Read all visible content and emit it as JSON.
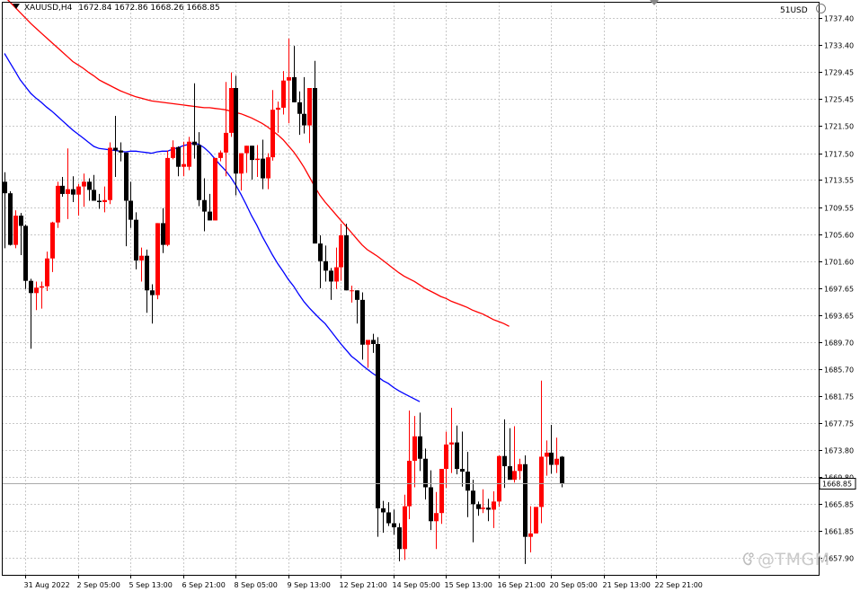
{
  "header": {
    "symbol": "XAUUSD,H4",
    "ohlc": "1672.84 1672.86 1668.26 1668.85",
    "account_tag": "51USD"
  },
  "current_price_label": "1668.85",
  "watermark": {
    "text": "@TMGM",
    "icon": "weibo-icon"
  },
  "colors": {
    "bull": "#ff0000",
    "bear": "#000000",
    "ma_slow": "#ff0000",
    "ma_fast": "#0000ff",
    "grid": "#c8c8c8",
    "background": "#ffffff"
  },
  "chart_data": {
    "type": "candlestick",
    "title": "",
    "xlabel": "",
    "ylabel": "",
    "timeframe": "H4",
    "ylim": [
      1655.4,
      1739.8
    ],
    "grid": true,
    "y_ticks": [
      1737.4,
      1733.4,
      1729.45,
      1725.45,
      1721.5,
      1717.5,
      1713.55,
      1709.55,
      1705.6,
      1701.6,
      1697.65,
      1693.65,
      1689.7,
      1685.7,
      1681.75,
      1677.75,
      1673.8,
      1669.8,
      1665.85,
      1661.85,
      1657.9
    ],
    "x_ticks": [
      {
        "label": "31 Aug 2022",
        "bar": 4
      },
      {
        "label": "2 Sep 05:00",
        "bar": 14
      },
      {
        "label": "5 Sep 13:00",
        "bar": 24
      },
      {
        "label": "6 Sep 21:00",
        "bar": 34
      },
      {
        "label": "8 Sep 05:00",
        "bar": 44
      },
      {
        "label": "9 Sep 13:00",
        "bar": 54
      },
      {
        "label": "12 Sep 21:00",
        "bar": 64
      },
      {
        "label": "14 Sep 05:00",
        "bar": 74
      },
      {
        "label": "15 Sep 13:00",
        "bar": 84
      },
      {
        "label": "16 Sep 21:00",
        "bar": 94
      },
      {
        "label": "20 Sep 05:00",
        "bar": 104
      },
      {
        "label": "21 Sep 13:00",
        "bar": 114
      },
      {
        "label": "22 Sep 21:00",
        "bar": 124
      }
    ],
    "candles": [
      [
        1713.3,
        1714.7,
        1703.5,
        1711.6
      ],
      [
        1711.6,
        1711.9,
        1703.9,
        1704.0
      ],
      [
        1704.0,
        1709.1,
        1703.5,
        1708.3
      ],
      [
        1708.3,
        1708.7,
        1702.5,
        1706.8
      ],
      [
        1706.8,
        1707.0,
        1697.5,
        1698.7
      ],
      [
        1698.7,
        1699.0,
        1688.7,
        1696.9
      ],
      [
        1696.9,
        1698.6,
        1694.4,
        1697.7
      ],
      [
        1697.7,
        1698.6,
        1694.6,
        1697.9
      ],
      [
        1697.9,
        1703.0,
        1697.2,
        1702.0
      ],
      [
        1702.0,
        1707.4,
        1700.0,
        1707.3
      ],
      [
        1707.3,
        1713.3,
        1706.5,
        1712.7
      ],
      [
        1712.7,
        1714.0,
        1711.1,
        1711.5
      ],
      [
        1711.5,
        1718.2,
        1707.8,
        1712.2
      ],
      [
        1712.2,
        1714.1,
        1710.3,
        1711.4
      ],
      [
        1711.4,
        1713.0,
        1708.3,
        1712.6
      ],
      [
        1712.6,
        1714.5,
        1709.6,
        1713.3
      ],
      [
        1713.3,
        1713.8,
        1710.5,
        1712.1
      ],
      [
        1712.1,
        1714.3,
        1711.6,
        1710.5
      ],
      [
        1710.5,
        1711.5,
        1709.3,
        1710.3
      ],
      [
        1710.3,
        1712.6,
        1708.8,
        1710.6
      ],
      [
        1710.6,
        1719.1,
        1710.0,
        1718.3
      ],
      [
        1718.3,
        1723.0,
        1714.0,
        1717.9
      ],
      [
        1717.9,
        1719.1,
        1716.3,
        1717.6
      ],
      [
        1717.6,
        1716.2,
        1703.8,
        1710.5
      ],
      [
        1710.5,
        1713.3,
        1706.5,
        1707.7
      ],
      [
        1707.7,
        1708.8,
        1700.4,
        1701.7
      ],
      [
        1701.7,
        1703.6,
        1698.6,
        1702.4
      ],
      [
        1702.4,
        1703.3,
        1694.0,
        1697.3
      ],
      [
        1697.3,
        1698.2,
        1692.4,
        1696.6
      ],
      [
        1696.6,
        1707.2,
        1696.0,
        1707.2
      ],
      [
        1707.2,
        1709.4,
        1702.8,
        1704.0
      ],
      [
        1704.0,
        1717.9,
        1703.8,
        1716.8
      ],
      [
        1716.8,
        1719.4,
        1716.6,
        1718.4
      ],
      [
        1718.4,
        1718.5,
        1714.1,
        1715.5
      ],
      [
        1715.5,
        1719.2,
        1714.1,
        1715.9
      ],
      [
        1715.5,
        1719.9,
        1715.0,
        1719.2
      ],
      [
        1719.2,
        1727.8,
        1716.7,
        1718.7
      ],
      [
        1718.7,
        1720.6,
        1709.7,
        1710.6
      ],
      [
        1710.6,
        1713.8,
        1706.0,
        1708.9
      ],
      [
        1708.9,
        1711.5,
        1707.8,
        1707.6
      ],
      [
        1707.6,
        1712.7,
        1714.2,
        1716.8
      ],
      [
        1716.8,
        1717.9,
        1716.3,
        1717.6
      ],
      [
        1717.6,
        1728.0,
        1714.1,
        1720.5
      ],
      [
        1720.5,
        1729.4,
        1719.9,
        1727.1
      ],
      [
        1727.1,
        1728.9,
        1711.3,
        1714.5
      ],
      [
        1714.5,
        1716.9,
        1712.0,
        1717.5
      ],
      [
        1717.5,
        1718.4,
        1714.6,
        1718.6
      ],
      [
        1718.6,
        1717.0,
        1713.6,
        1716.5
      ],
      [
        1716.5,
        1718.7,
        1714.0,
        1716.7
      ],
      [
        1716.7,
        1719.5,
        1712.2,
        1713.8
      ],
      [
        1713.8,
        1717.5,
        1712.2,
        1716.9
      ],
      [
        1716.9,
        1726.8,
        1716.4,
        1723.9
      ],
      [
        1723.9,
        1725.1,
        1720.5,
        1724.2
      ],
      [
        1724.2,
        1729.6,
        1723.2,
        1728.2
      ],
      [
        1728.2,
        1734.4,
        1721.9,
        1728.7
      ],
      [
        1728.7,
        1733.3,
        1727.3,
        1725.0
      ],
      [
        1725.0,
        1726.6,
        1720.2,
        1723.3
      ],
      [
        1723.3,
        1728.7,
        1720.4,
        1721.6
      ],
      [
        1721.6,
        1725.9,
        1719.0,
        1727.1
      ],
      [
        1727.1,
        1731.1,
        1720.7,
        1704.2
      ],
      [
        1704.2,
        1705.4,
        1697.6,
        1701.6
      ],
      [
        1701.6,
        1703.9,
        1698.6,
        1700.2
      ],
      [
        1700.2,
        1700.6,
        1695.9,
        1698.6
      ],
      [
        1698.6,
        1703.6,
        1697.5,
        1700.7
      ],
      [
        1700.7,
        1707.1,
        1698.7,
        1705.4
      ],
      [
        1705.4,
        1707.1,
        1698.6,
        1697.3
      ],
      [
        1697.3,
        1698.0,
        1695.5,
        1697.3
      ],
      [
        1697.3,
        1696.4,
        1692.4,
        1695.9
      ],
      [
        1695.9,
        1697.0,
        1687.1,
        1689.3
      ],
      [
        1689.3,
        1688.5,
        1685.9,
        1690.0
      ],
      [
        1690.0,
        1690.9,
        1688.1,
        1689.4
      ],
      [
        1689.4,
        1690.4,
        1661.0,
        1665.2
      ],
      [
        1665.2,
        1666.3,
        1661.6,
        1664.6
      ],
      [
        1664.6,
        1666.1,
        1662.6,
        1663.0
      ],
      [
        1663.0,
        1665.0,
        1661.3,
        1662.4
      ],
      [
        1662.4,
        1663.0,
        1657.4,
        1659.2
      ],
      [
        1659.2,
        1667.2,
        1657.6,
        1665.5
      ],
      [
        1665.5,
        1679.6,
        1663.6,
        1672.2
      ],
      [
        1672.2,
        1678.8,
        1668.3,
        1675.8
      ],
      [
        1675.8,
        1679.3,
        1670.7,
        1672.5
      ],
      [
        1672.5,
        1674.0,
        1666.5,
        1668.3
      ],
      [
        1668.3,
        1670.8,
        1662.0,
        1663.3
      ],
      [
        1663.3,
        1667.6,
        1659.2,
        1664.5
      ],
      [
        1664.5,
        1670.6,
        1662.9,
        1671.0
      ],
      [
        1671.0,
        1676.5,
        1668.2,
        1674.6
      ],
      [
        1674.6,
        1680.0,
        1670.4,
        1674.9
      ],
      [
        1674.9,
        1677.4,
        1670.2,
        1671.0
      ],
      [
        1671.0,
        1676.5,
        1668.4,
        1670.6
      ],
      [
        1670.6,
        1673.5,
        1663.9,
        1667.8
      ],
      [
        1667.8,
        1669.4,
        1660.2,
        1665.8
      ],
      [
        1665.8,
        1666.2,
        1664.1,
        1665.1
      ],
      [
        1665.1,
        1668.0,
        1664.5,
        1665.3
      ],
      [
        1665.3,
        1666.6,
        1663.3,
        1665.0
      ],
      [
        1665.0,
        1667.7,
        1662.3,
        1666.2
      ],
      [
        1666.2,
        1673.0,
        1665.4,
        1672.9
      ],
      [
        1672.9,
        1678.3,
        1668.2,
        1671.4
      ],
      [
        1671.4,
        1677.0,
        1669.5,
        1669.4
      ],
      [
        1669.4,
        1677.3,
        1669.0,
        1670.7
      ],
      [
        1670.7,
        1672.5,
        1669.4,
        1671.7
      ],
      [
        1671.7,
        1673.0,
        1657.0,
        1661.0
      ],
      [
        1661.0,
        1665.5,
        1658.7,
        1661.5
      ],
      [
        1661.5,
        1663.6,
        1662.0,
        1665.4
      ],
      [
        1665.4,
        1684.0,
        1663.0,
        1672.8
      ],
      [
        1672.8,
        1675.2,
        1670.0,
        1673.4
      ],
      [
        1673.4,
        1677.5,
        1670.3,
        1671.6
      ],
      [
        1671.6,
        1675.6,
        1670.4,
        1672.5
      ],
      [
        1672.8,
        1672.9,
        1668.3,
        1668.9
      ]
    ],
    "series": [
      {
        "type": "ma",
        "color": "#ff0000",
        "values": [
          1740.6,
          1739.8,
          1739.0,
          1738.2,
          1737.4,
          1736.6,
          1735.9,
          1735.2,
          1734.5,
          1733.8,
          1733.1,
          1732.4,
          1731.7,
          1731.0,
          1730.5,
          1730.0,
          1729.4,
          1728.9,
          1728.3,
          1727.9,
          1727.5,
          1727.1,
          1726.7,
          1726.4,
          1726.1,
          1725.8,
          1725.6,
          1725.4,
          1725.2,
          1725.1,
          1725.0,
          1724.9,
          1724.8,
          1724.7,
          1724.6,
          1724.5,
          1724.4,
          1724.3,
          1724.2,
          1724.2,
          1724.1,
          1724.0,
          1723.9,
          1723.7,
          1723.5,
          1723.3,
          1723.0,
          1722.7,
          1722.3,
          1721.9,
          1721.4,
          1720.8,
          1720.2,
          1719.5,
          1718.6,
          1717.7,
          1716.6,
          1715.4,
          1714.0,
          1712.6,
          1711.3,
          1710.3,
          1709.4,
          1708.5,
          1707.6,
          1706.7,
          1705.8,
          1704.9,
          1704.0,
          1703.3,
          1702.8,
          1702.3,
          1701.7,
          1701.1,
          1700.5,
          1699.9,
          1699.4,
          1699.0,
          1698.6,
          1698.1,
          1697.6,
          1697.2,
          1696.8,
          1696.4,
          1696.1,
          1695.7,
          1695.4,
          1695.1,
          1694.8,
          1694.4,
          1694.1,
          1693.8,
          1693.4,
          1693.0,
          1692.7,
          1692.4,
          1692.0
        ]
      },
      {
        "type": "ma",
        "color": "#0000ff",
        "values": [
          1732.2,
          1730.9,
          1729.6,
          1728.3,
          1727.3,
          1726.3,
          1725.6,
          1725.0,
          1724.3,
          1723.7,
          1723.0,
          1722.3,
          1721.6,
          1720.9,
          1720.3,
          1719.7,
          1719.1,
          1718.5,
          1718.2,
          1718.1,
          1718.0,
          1717.9,
          1717.8,
          1717.7,
          1717.8,
          1717.8,
          1717.7,
          1717.6,
          1717.5,
          1717.7,
          1717.8,
          1717.8,
          1718.1,
          1718.3,
          1718.6,
          1718.8,
          1719.0,
          1718.8,
          1718.3,
          1717.6,
          1716.7,
          1715.8,
          1715.0,
          1714.0,
          1712.8,
          1711.4,
          1709.9,
          1708.3,
          1706.9,
          1705.3,
          1703.9,
          1702.5,
          1701.2,
          1700.1,
          1698.9,
          1697.9,
          1696.7,
          1695.6,
          1694.7,
          1693.9,
          1693.1,
          1692.4,
          1691.4,
          1690.4,
          1689.4,
          1688.5,
          1687.6,
          1687.0,
          1686.3,
          1685.7,
          1685.1,
          1684.6,
          1684.0,
          1683.6,
          1683.0,
          1682.5,
          1682.1,
          1681.7,
          1681.3,
          1680.9
        ]
      }
    ]
  }
}
